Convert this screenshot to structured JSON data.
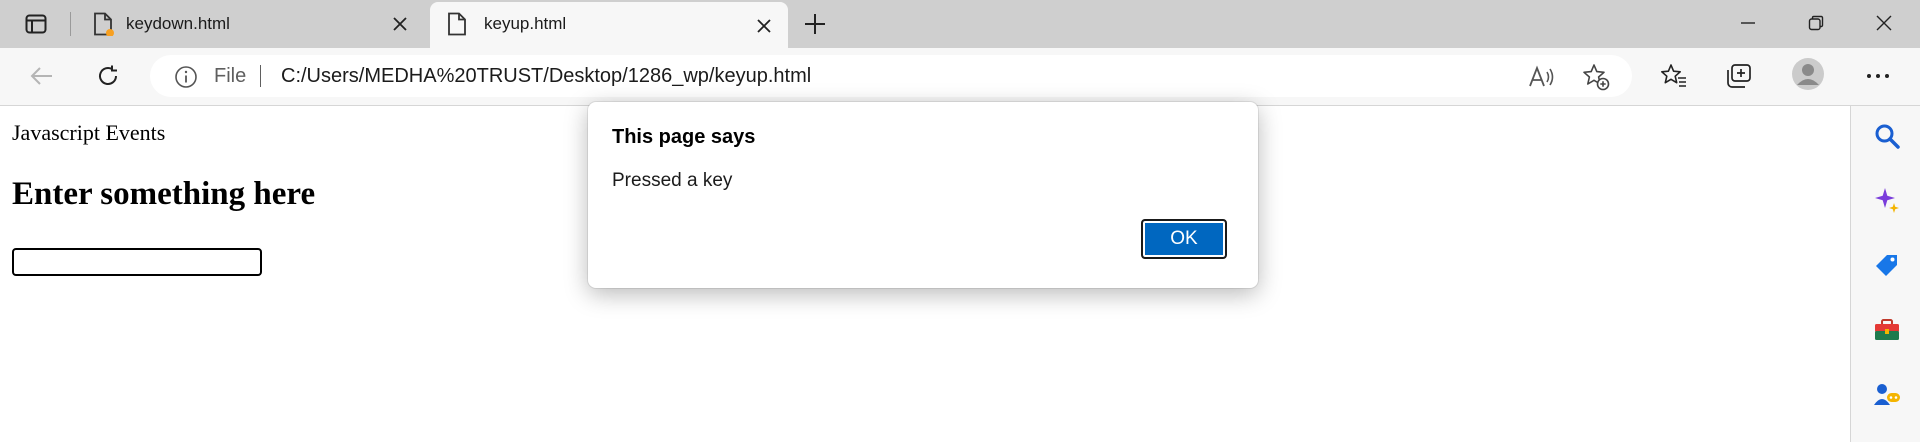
{
  "tabs": [
    {
      "title": "keydown.html",
      "active": false,
      "has_activity_dot": true
    },
    {
      "title": "keyup.html",
      "active": true,
      "has_activity_dot": false
    }
  ],
  "toolbar": {
    "address": {
      "scheme_label": "File",
      "url": "C:/Users/MEDHA%20TRUST/Desktop/1286_wp/keyup.html"
    }
  },
  "page": {
    "text": "Javascript Events",
    "heading": "Enter something here",
    "input_value": ""
  },
  "dialog": {
    "title": "This page says",
    "message": "Pressed a key",
    "ok_label": "OK"
  },
  "sidebar": {
    "items": [
      "search-icon",
      "copilot-icon",
      "shopping-icon",
      "tools-icon",
      "games-icon"
    ]
  },
  "colors": {
    "accent": "#0067c0",
    "tabstrip": "#cfcfcf",
    "toolbar": "#f7f7f7",
    "activity_dot": "#f7a021"
  }
}
